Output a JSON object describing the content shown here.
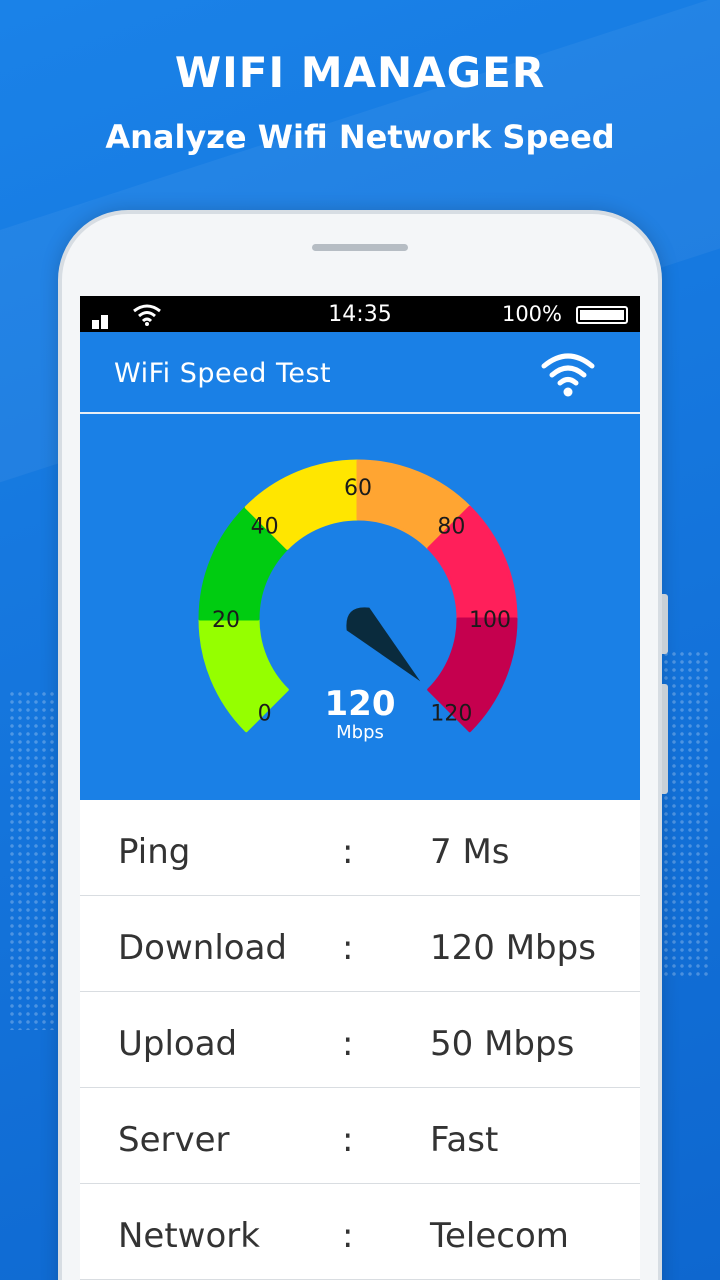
{
  "headline": "WIFI MANAGER",
  "subheadline": "Analyze Wifi Network Speed",
  "status_bar": {
    "time": "14:35",
    "battery_percent": "100%"
  },
  "app_bar": {
    "title": "WiFi Speed Test",
    "icon": "wifi-icon"
  },
  "gauge": {
    "ticks": [
      "0",
      "20",
      "40",
      "60",
      "80",
      "100",
      "120"
    ],
    "value": "120",
    "unit": "Mbps",
    "needle_value": 120,
    "max": 120,
    "segment_colors": [
      "#95ff00",
      "#00cc11",
      "#ffe600",
      "#ffa532",
      "#ff1f5a",
      "#c5004e"
    ]
  },
  "stats": [
    {
      "label": "Ping",
      "sep": ":",
      "value": "7 Ms"
    },
    {
      "label": "Download",
      "sep": ":",
      "value": "120 Mbps"
    },
    {
      "label": "Upload",
      "sep": ":",
      "value": "50 Mbps"
    },
    {
      "label": "Server",
      "sep": ":",
      "value": "Fast"
    },
    {
      "label": "Network",
      "sep": ":",
      "value": "Telecom"
    }
  ]
}
